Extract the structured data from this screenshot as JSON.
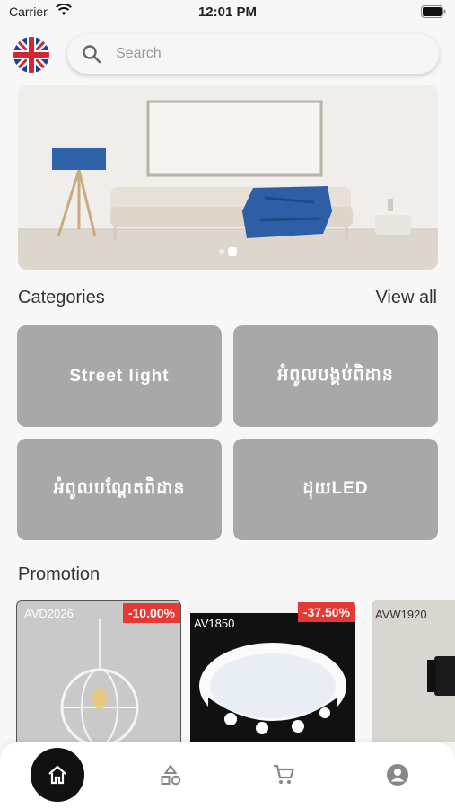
{
  "status": {
    "carrier": "Carrier",
    "time": "12:01 PM"
  },
  "header": {
    "language_flag": "uk-flag-icon",
    "search_placeholder": "Search"
  },
  "banner": {
    "image": "living-room-lamp-sofa",
    "dots": 2,
    "active_dot": 1
  },
  "categories": {
    "title": "Categories",
    "view_all": "View all",
    "items": [
      {
        "label": "Street light"
      },
      {
        "label": "អំពូលបង្គប់ពិដាន"
      },
      {
        "label": "អំពូលបណ្ដែតពិដាន"
      },
      {
        "label": "ដុយLED"
      }
    ]
  },
  "promotion": {
    "title": "Promotion",
    "items": [
      {
        "discount": "-10.00%",
        "code": "AVD2026"
      },
      {
        "discount": "-37.50%",
        "code": "AV1850"
      },
      {
        "discount": "",
        "code": "AVW1920"
      }
    ]
  },
  "nav": {
    "items": [
      "home-icon",
      "categories-icon",
      "cart-icon",
      "account-icon"
    ],
    "active": "home-icon"
  },
  "colors": {
    "accent_dark": "#111111",
    "category_bg": "#a8a8a8",
    "discount_badge": "#e53935"
  }
}
